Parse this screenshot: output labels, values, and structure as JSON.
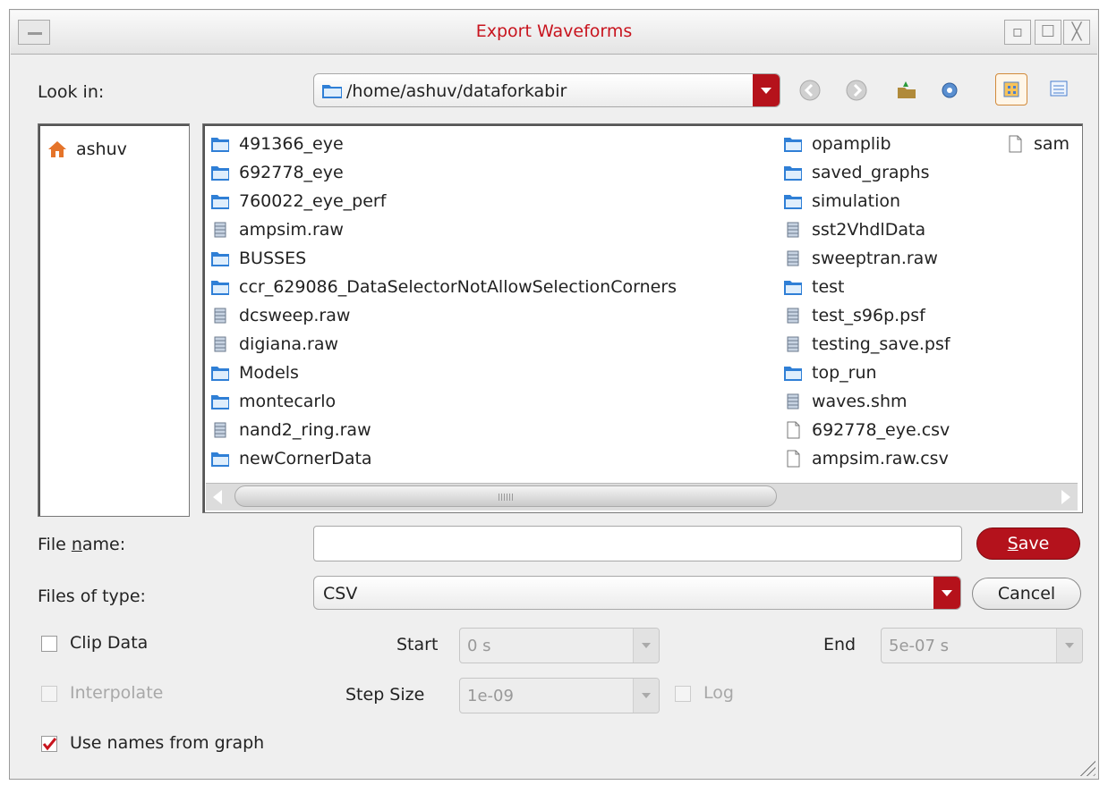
{
  "window": {
    "title": "Export Waveforms"
  },
  "lookin": {
    "label": "Look in:",
    "path": "/home/ashuv/dataforkabir"
  },
  "places": [
    {
      "label": "ashuv",
      "icon": "home-icon"
    }
  ],
  "files": {
    "col1": [
      {
        "name": "491366_eye",
        "type": "folder"
      },
      {
        "name": "692778_eye",
        "type": "folder"
      },
      {
        "name": "760022_eye_perf",
        "type": "folder"
      },
      {
        "name": "ampsim.raw",
        "type": "data"
      },
      {
        "name": "BUSSES",
        "type": "folder"
      },
      {
        "name": "ccr_629086_DataSelectorNotAllowSelectionCorners",
        "type": "folder"
      },
      {
        "name": "dcsweep.raw",
        "type": "data"
      },
      {
        "name": "digiana.raw",
        "type": "data"
      },
      {
        "name": "Models",
        "type": "folder"
      },
      {
        "name": "montecarlo",
        "type": "folder"
      },
      {
        "name": "nand2_ring.raw",
        "type": "data"
      },
      {
        "name": "newCornerData",
        "type": "folder"
      }
    ],
    "col2": [
      {
        "name": "opamplib",
        "type": "folder"
      },
      {
        "name": "saved_graphs",
        "type": "folder"
      },
      {
        "name": "simulation",
        "type": "folder"
      },
      {
        "name": "sst2VhdlData",
        "type": "data"
      },
      {
        "name": "sweeptran.raw",
        "type": "data"
      },
      {
        "name": "test",
        "type": "folder"
      },
      {
        "name": "test_s96p.psf",
        "type": "data"
      },
      {
        "name": "testing_save.psf",
        "type": "data"
      },
      {
        "name": "top_run",
        "type": "folder"
      },
      {
        "name": "waves.shm",
        "type": "data"
      },
      {
        "name": "692778_eye.csv",
        "type": "file"
      },
      {
        "name": "ampsim.raw.csv",
        "type": "file"
      }
    ],
    "col3": [
      {
        "name": "sam",
        "type": "file"
      }
    ]
  },
  "filename": {
    "label": "File name:",
    "value": "",
    "save": "Save"
  },
  "filetype": {
    "label": "Files of type:",
    "value": "CSV",
    "cancel": "Cancel"
  },
  "options": {
    "clip_data": "Clip Data",
    "start_label": "Start",
    "start_value": "0 s",
    "end_label": "End",
    "end_value": "5e-07 s",
    "interpolate": "Interpolate",
    "step_label": "Step Size",
    "step_value": "1e-09",
    "log": "Log",
    "use_names": "Use names from graph",
    "use_names_checked": true
  },
  "colors": {
    "accent": "#b4121c",
    "title": "#c8141e",
    "folder": "#2f7fd6"
  }
}
